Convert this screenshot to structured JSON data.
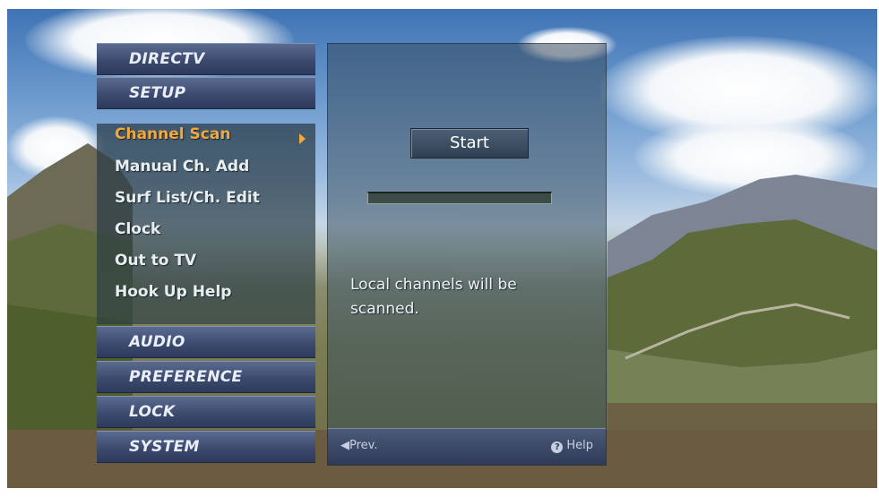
{
  "menu": {
    "top_headers": [
      "DIRECTV",
      "SETUP"
    ],
    "items": [
      {
        "label": "Channel Scan",
        "active": true
      },
      {
        "label": "Manual Ch. Add",
        "active": false
      },
      {
        "label": "Surf List/Ch. Edit",
        "active": false
      },
      {
        "label": "Clock",
        "active": false
      },
      {
        "label": "Out to TV",
        "active": false
      },
      {
        "label": "Hook Up Help",
        "active": false
      }
    ],
    "bottom_headers": [
      "AUDIO",
      "PREFERENCE",
      "LOCK",
      "SYSTEM"
    ]
  },
  "content": {
    "start_label": "Start",
    "progress": 0,
    "info_text": "Local channels will be scanned.",
    "prev_label": "Prev.",
    "help_label": "Help"
  },
  "colors": {
    "active_item": "#f3a83b",
    "header_bar": "#3c4a6e"
  }
}
